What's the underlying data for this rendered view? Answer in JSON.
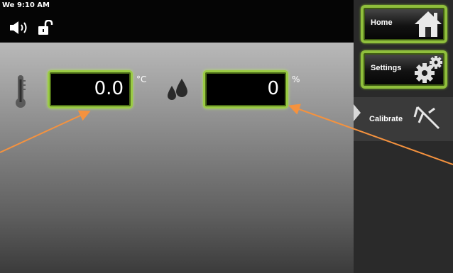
{
  "status_bar": {
    "clock": "We 9:10 AM",
    "icons": [
      "speaker-icon",
      "unlocked-icon"
    ]
  },
  "readings": {
    "temperature": {
      "value": "0.0",
      "unit": "°C",
      "icon": "thermometer-icon"
    },
    "humidity": {
      "value": "0",
      "unit": "%",
      "icon": "water-drops-icon"
    }
  },
  "nav": {
    "home": {
      "label": "Home",
      "icon": "house-icon"
    },
    "settings": {
      "label": "Settings",
      "icon": "gears-icon"
    },
    "calibrate": {
      "label": "Calibrate",
      "icon": "caliper-icon"
    }
  },
  "colors": {
    "field_border": "#9acb44",
    "annotation_arrow": "#f5923e",
    "nav_background": "#2a2a2a"
  }
}
